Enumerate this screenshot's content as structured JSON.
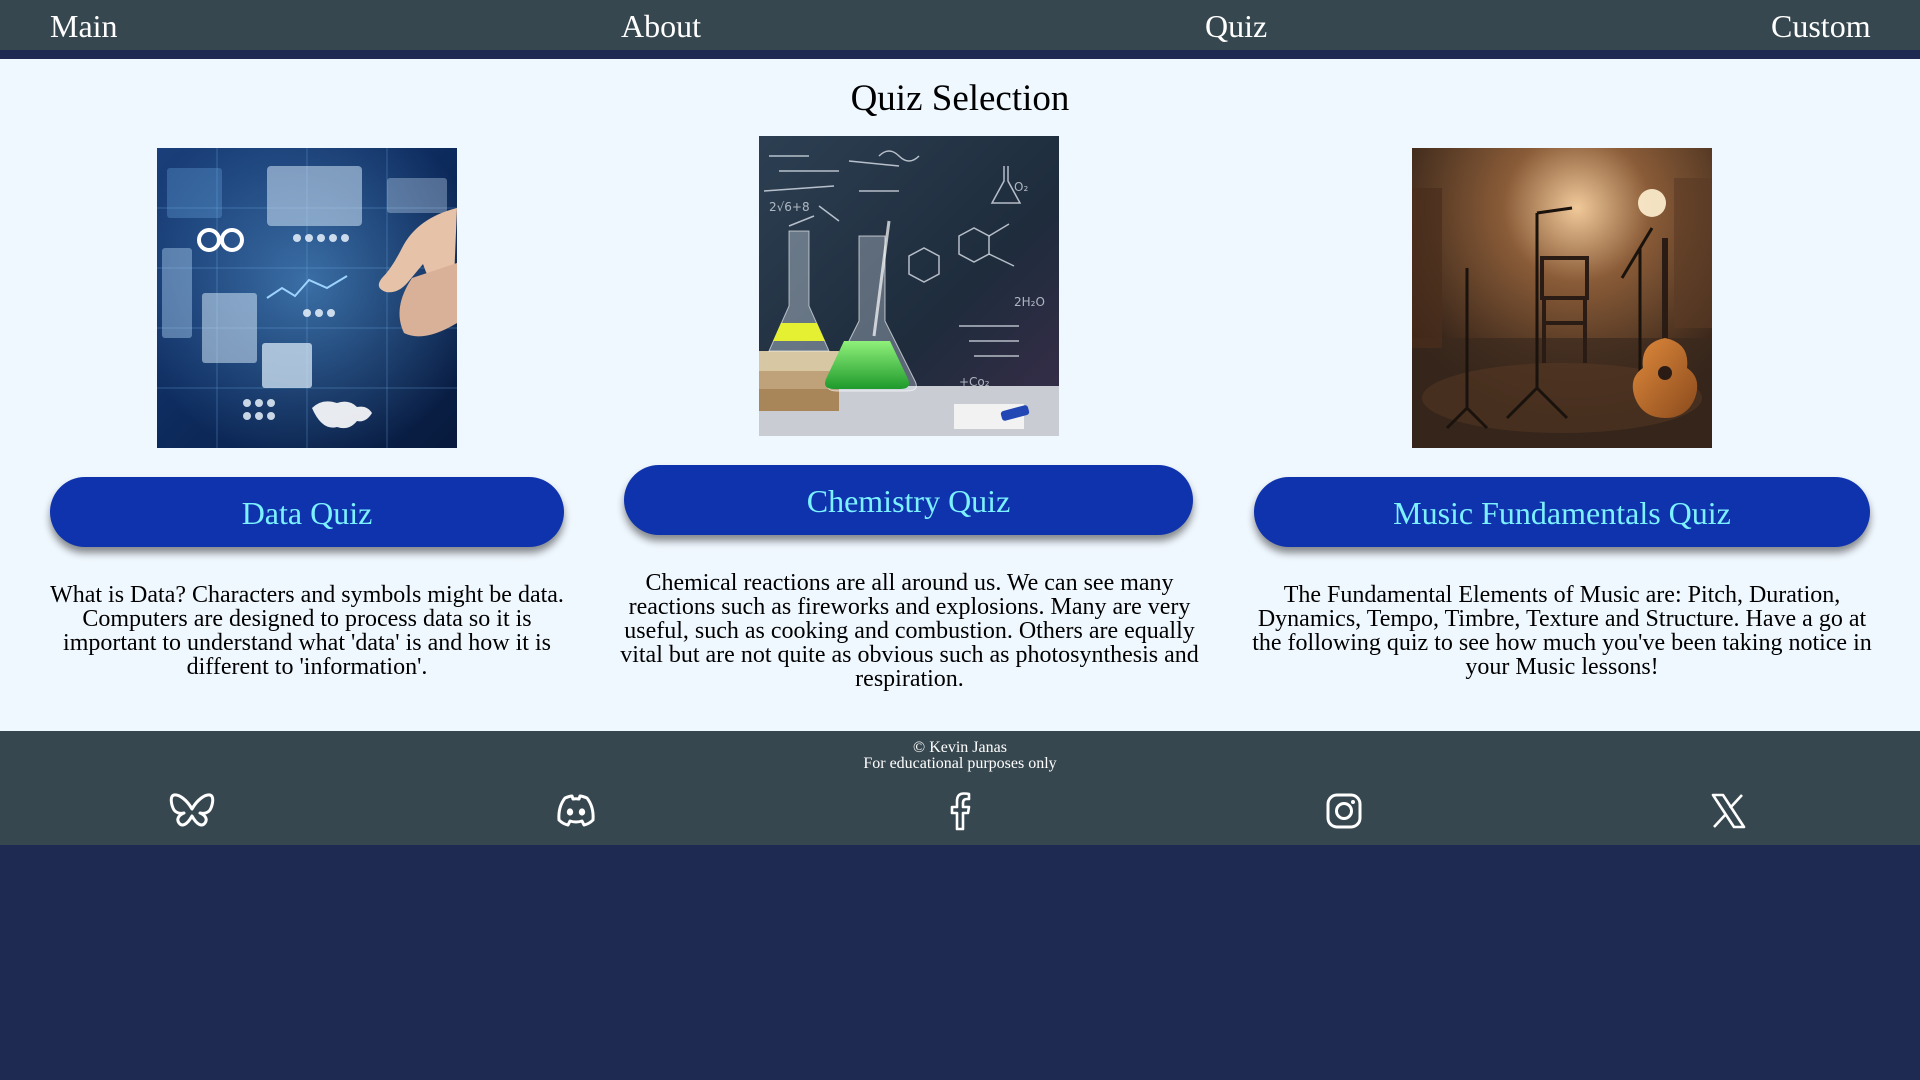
{
  "nav": {
    "main": "Main",
    "about": "About",
    "quiz": "Quiz",
    "custom": "Custom"
  },
  "page": {
    "title": "Quiz Selection"
  },
  "quizzes": [
    {
      "button_label": "Data Quiz",
      "description": "What is Data? Characters and symbols might be data. Computers are designed to process data so it is important to understand what 'data' is and how it is different to 'information'."
    },
    {
      "button_label": "Chemistry Quiz",
      "description": "Chemical reactions are all around us. We can see many reactions such as fireworks and explosions. Many are very useful, such as cooking and combustion. Others are equally vital but are not quite as obvious such as photosynthesis and respiration."
    },
    {
      "button_label": "Music Fundamentals Quiz",
      "description": "The Fundamental Elements of Music are: Pitch, Duration, Dynamics, Tempo, Timbre, Texture and Structure. Have a go at the following quiz to see how much you've been taking notice in your Music lessons!"
    }
  ],
  "footer": {
    "copyright": "© Kevin Janas",
    "note": "For educational purposes only",
    "social_icons": [
      "bluesky-icon",
      "discord-icon",
      "facebook-icon",
      "instagram-icon",
      "x-icon"
    ]
  },
  "colors": {
    "nav_bg": "#37474f",
    "page_bg": "#f0f8ff",
    "accent_dark": "#1e2a52",
    "button_bg": "#0f33ad",
    "button_text": "#7cf1ff"
  }
}
